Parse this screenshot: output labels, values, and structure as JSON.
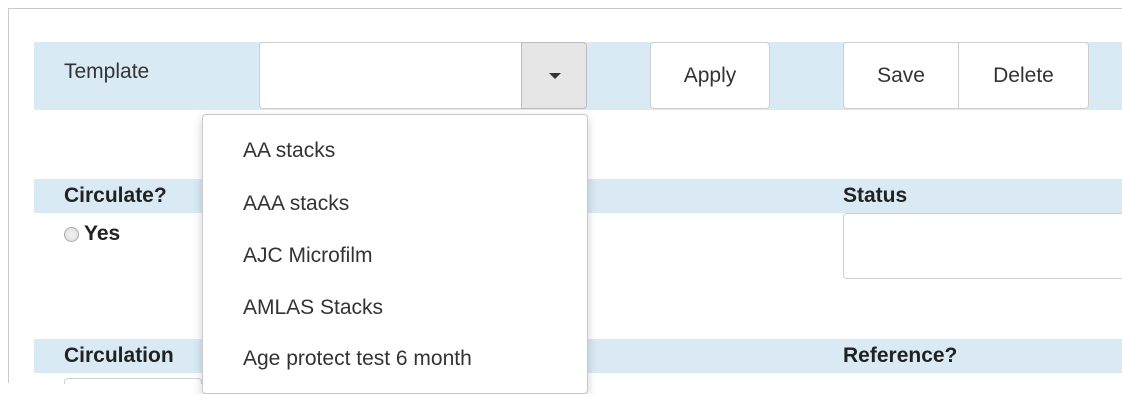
{
  "toolbar": {
    "template_label": "Template",
    "template_value": "",
    "apply_label": "Apply",
    "save_label": "Save",
    "delete_label": "Delete"
  },
  "form": {
    "circulate_label": "Circulate?",
    "yes_label": "Yes",
    "status_label": "Status",
    "status_value": "",
    "circulation_label": "Circulation",
    "reference_label": "Reference?"
  },
  "dropdown": {
    "items": [
      "AA stacks",
      "AAA stacks",
      "AJC Microfilm",
      "AMLAS Stacks",
      "Age protect test 6 month"
    ]
  },
  "colors": {
    "band": "#d9eaf5",
    "border": "#cfcfcf",
    "caret_button": "#e6e6e6"
  },
  "icons": {
    "caret": "chevron-down-icon",
    "radio": "radio-unchecked"
  }
}
